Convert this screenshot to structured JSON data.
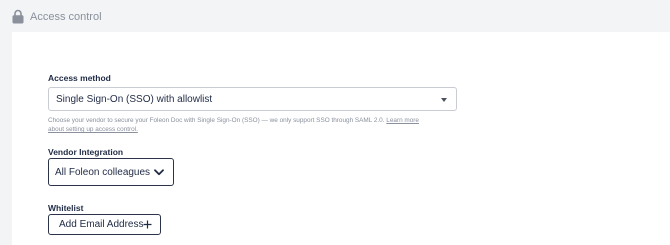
{
  "header": {
    "title": "Access control",
    "icon": "lock-icon"
  },
  "access_method": {
    "label": "Access method",
    "selected": "Single Sign-On (SSO) with allowlist",
    "help_text": "Choose your vendor to secure your Foleon Doc with Single Sign-On (SSO) — we only support SSO through SAML 2.0.",
    "help_link_line1": "Learn more",
    "help_link_line2": "about setting up access control."
  },
  "vendor": {
    "label": "Vendor Integration",
    "selected": "All Foleon colleagues",
    "icon": "chevron-down-icon"
  },
  "whitelist": {
    "label": "Whitelist",
    "add_button_label": "Add Email Address",
    "icon": "plus-icon"
  }
}
